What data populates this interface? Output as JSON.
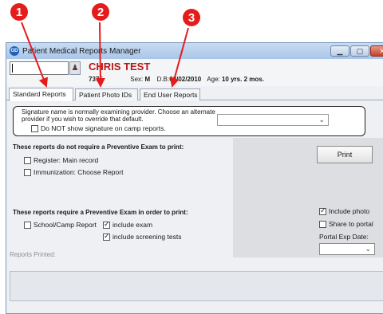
{
  "callouts": [
    "1",
    "2",
    "3"
  ],
  "colors": {
    "callout": "#e51c1c",
    "patient_name": "#b11a1a",
    "titlebar": "#a9c5e8"
  },
  "window": {
    "title": "Patient Medical Reports Manager",
    "app_icon": "OD",
    "controls": {
      "minimize": "▁",
      "maximize": "▢",
      "close": "✕"
    }
  },
  "patient": {
    "id_value": "",
    "name": "CHRIS TEST",
    "number": "7375",
    "sex_label": "Sex:",
    "sex": "M",
    "dob_label": "D.B:",
    "dob": "02/02/2010",
    "age_label": "Age:",
    "age": "10 yrs. 2 mos."
  },
  "tabs": [
    "Standard Reports",
    "Patient Photo IDs",
    "End User Reports"
  ],
  "signature": {
    "text": "Signature name is normally examining provider. Choose an alternate provider if you wish to override that default.",
    "select_value": "",
    "no_sig_label": "Do NOT show signature on camp reports."
  },
  "no_exam": {
    "heading": "These reports do not require a Preventive Exam to print:",
    "items": [
      "Register: Main record",
      "Immunization: Choose Report"
    ]
  },
  "exam": {
    "heading": "These reports require a Preventive Exam in order to print:",
    "school_label": "School/Camp Report",
    "include_exam": "include exam",
    "include_tests": "include screening tests"
  },
  "right": {
    "print": "Print",
    "include_photo": "Include photo",
    "share_portal": "Share to portal",
    "portal_exp_label": "Portal Exp Date:",
    "portal_exp_value": ""
  },
  "printed_label": "Reports Printed:"
}
